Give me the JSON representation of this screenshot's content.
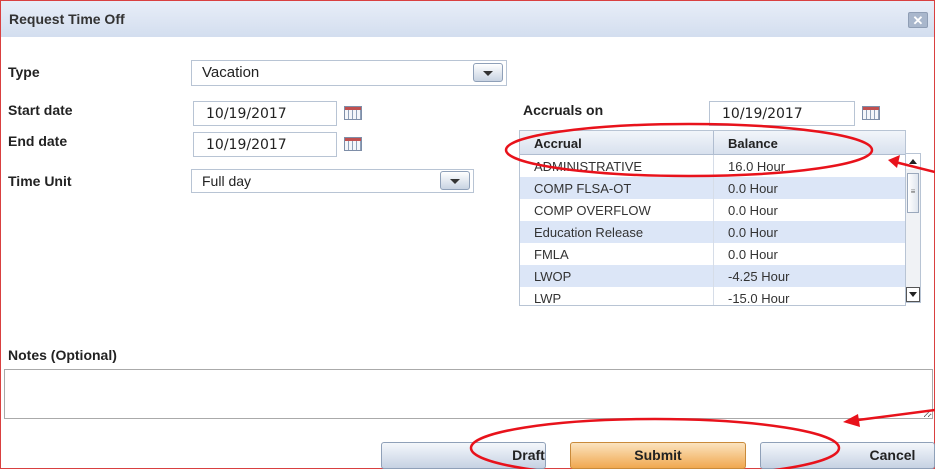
{
  "dialog": {
    "title": "Request Time Off",
    "close_symbol": "✕"
  },
  "form": {
    "type_label": "Type",
    "type_value": "Vacation",
    "start_label": "Start date",
    "start_value": "10/19/2017",
    "end_label": "End date",
    "end_value": "10/19/2017",
    "unit_label": "Time Unit",
    "unit_value": "Full day",
    "accruals_label": "Accruals on",
    "accruals_value": "10/19/2017",
    "notes_label": "Notes (Optional)",
    "notes_value": ""
  },
  "grid": {
    "headers": [
      "Accrual",
      "Balance"
    ],
    "rows": [
      {
        "accrual": "ADMINISTRATIVE",
        "balance": "16.0 Hour"
      },
      {
        "accrual": "COMP FLSA-OT",
        "balance": "0.0 Hour"
      },
      {
        "accrual": "COMP OVERFLOW",
        "balance": "0.0 Hour"
      },
      {
        "accrual": "Education Release",
        "balance": "0.0 Hour"
      },
      {
        "accrual": "FMLA",
        "balance": "0.0 Hour"
      },
      {
        "accrual": "LWOP",
        "balance": "-4.25 Hour"
      },
      {
        "accrual": "LWP",
        "balance": "-15.0 Hour"
      }
    ]
  },
  "buttons": {
    "draft": "Draft",
    "submit": "Submit",
    "cancel": "Cancel"
  },
  "colors": {
    "annotation": "#e8121b",
    "row_alt": "#dce6f7",
    "submit": "#f0a850"
  },
  "icons": [
    "close-icon",
    "calendar-icon",
    "dropdown-arrow-icon",
    "scroll-up-icon",
    "scroll-down-icon"
  ]
}
